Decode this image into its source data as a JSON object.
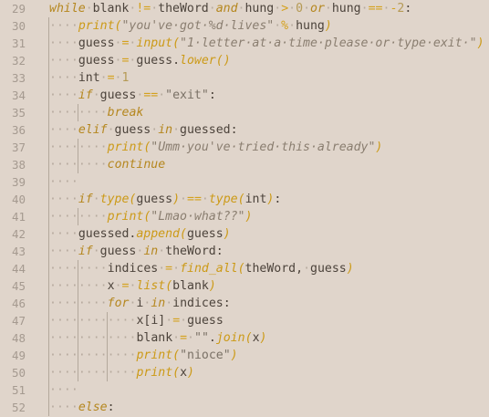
{
  "editor": {
    "line_numbers": [
      "29",
      "30",
      "31",
      "32",
      "33",
      "34",
      "35",
      "36",
      "37",
      "38",
      "39",
      "40",
      "41",
      "42",
      "43",
      "44",
      "45",
      "46",
      "47",
      "48",
      "49",
      "50",
      "51",
      "52"
    ],
    "lines": [
      "while blank != theWord and hung > 0 or hung == -2:",
      "    print(\"you've got %d lives\" % hung)",
      "    guess = input(\"1 letter at a time please or type exit \")",
      "    guess = guess.lower()",
      "    int = 1",
      "    if guess == \"exit\":",
      "        break",
      "    elif guess in guessed:",
      "        print(\"Umm you've tried this already\")",
      "        continue",
      "    ",
      "    if type(guess) == type(int):",
      "        print(\"Lmao what??\")",
      "    guessed.append(guess)",
      "    if guess in theWord:",
      "        indices = find_all(theWord, guess)",
      "        x = list(blank)",
      "        for i in indices:",
      "            x[i] = guess",
      "            blank = \"\".join(x)",
      "            print(\"nioce\")",
      "            print(x)",
      "    ",
      "    else:"
    ]
  },
  "colors": {
    "background": "#e0d5cb",
    "keyword": "#b5871f",
    "function": "#cc9a17",
    "string": "#7a7166",
    "gutter": "#a59a90"
  }
}
